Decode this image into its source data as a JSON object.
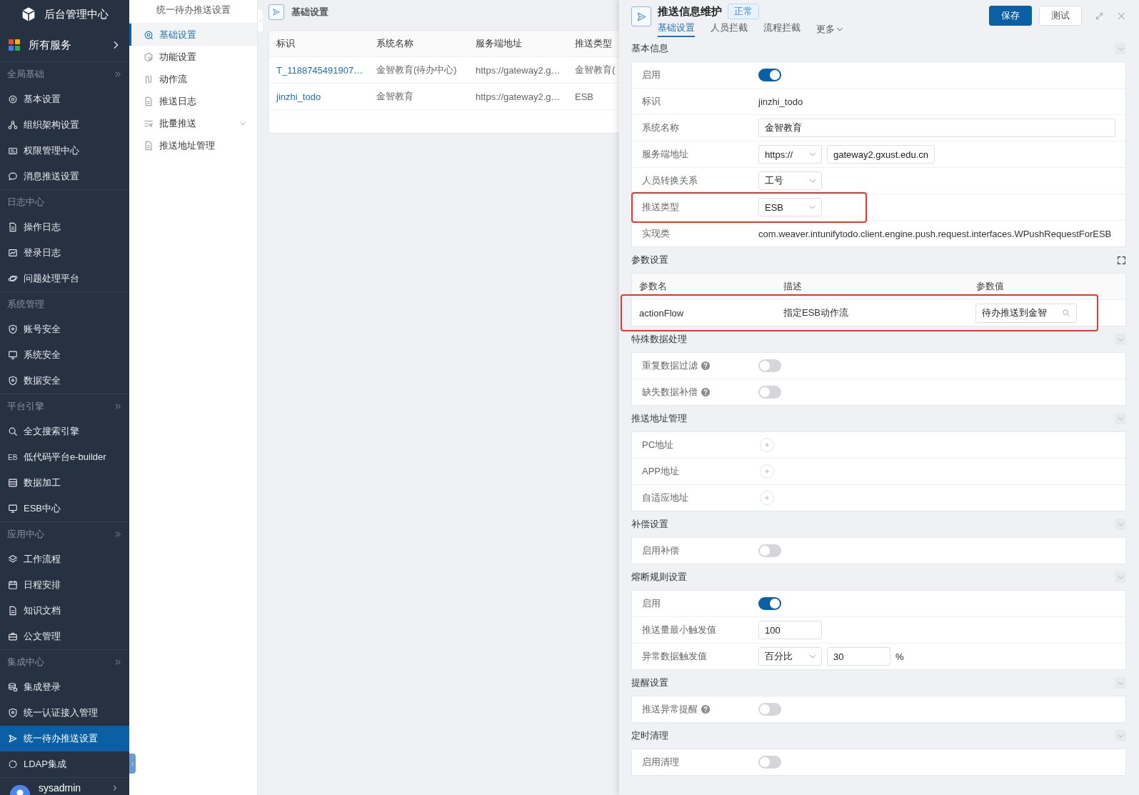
{
  "sidebar": {
    "title": "后台管理中心",
    "all_services": "所有服务",
    "groups": [
      {
        "title": "全局基础",
        "collapsible": true,
        "items": [
          {
            "label": "基本设置",
            "selected": false
          },
          {
            "label": "组织架构设置",
            "selected": false
          },
          {
            "label": "权限管理中心",
            "selected": false
          },
          {
            "label": "消息推送设置",
            "selected": false
          }
        ]
      },
      {
        "title": "日志中心",
        "collapsible": false,
        "items": [
          {
            "label": "操作日志",
            "selected": false
          },
          {
            "label": "登录日志",
            "selected": false
          },
          {
            "label": "问题处理平台",
            "selected": false
          }
        ]
      },
      {
        "title": "系统管理",
        "collapsible": false,
        "items": [
          {
            "label": "账号安全",
            "selected": false
          },
          {
            "label": "系统安全",
            "selected": false
          },
          {
            "label": "数据安全",
            "selected": false
          }
        ]
      },
      {
        "title": "平台引擎",
        "collapsible": true,
        "items": [
          {
            "label": "全文搜索引擎",
            "selected": false
          },
          {
            "label": "低代码平台e-builder",
            "selected": false,
            "icon_text": "EB"
          },
          {
            "label": "数据加工",
            "selected": false
          },
          {
            "label": "ESB中心",
            "selected": false
          }
        ]
      },
      {
        "title": "应用中心",
        "collapsible": true,
        "items": [
          {
            "label": "工作流程",
            "selected": false
          },
          {
            "label": "日程安排",
            "selected": false
          },
          {
            "label": "知识文档",
            "selected": false
          },
          {
            "label": "公文管理",
            "selected": false
          }
        ]
      },
      {
        "title": "集成中心",
        "collapsible": true,
        "items": [
          {
            "label": "集成登录",
            "selected": false
          },
          {
            "label": "统一认证接入管理",
            "selected": false
          },
          {
            "label": "统一待办推送设置",
            "selected": true
          },
          {
            "label": "LDAP集成",
            "selected": false
          }
        ]
      }
    ],
    "user": {
      "name": "sysadmin"
    }
  },
  "subnav": {
    "title": "统一待办推送设置",
    "items": [
      {
        "label": "基础设置",
        "selected": true,
        "expandable": false
      },
      {
        "label": "功能设置",
        "selected": false,
        "expandable": false
      },
      {
        "label": "动作流",
        "selected": false,
        "expandable": false
      },
      {
        "label": "推送日志",
        "selected": false,
        "expandable": false
      },
      {
        "label": "批量推送",
        "selected": false,
        "expandable": true
      },
      {
        "label": "推送地址管理",
        "selected": false,
        "expandable": false
      }
    ]
  },
  "list": {
    "title": "基础设置",
    "columns": [
      "标识",
      "系统名称",
      "服务端地址",
      "推送类型"
    ],
    "rows": [
      {
        "cells": [
          "T_1188745491907…",
          "金智教育(待办中心)",
          "https://gateway2.g…",
          "金智教育("
        ]
      },
      {
        "cells": [
          "jinzhi_todo",
          "金智教育",
          "https://gateway2.g…",
          "ESB"
        ]
      }
    ]
  },
  "drawer": {
    "title": "推送信息维护",
    "status": "正常",
    "tabs": [
      {
        "label": "基础设置",
        "selected": true
      },
      {
        "label": "人员拦截",
        "selected": false
      },
      {
        "label": "流程拦截",
        "selected": false
      }
    ],
    "more": "更多",
    "buttons": [
      {
        "label": "保存",
        "primary": true
      },
      {
        "label": "测试",
        "primary": false
      }
    ],
    "sections": [
      {
        "title": "基本信息",
        "kind": "form",
        "rows": [
          {
            "label": "启用",
            "kind": "toggle",
            "on": true,
            "help": false,
            "highlighted": false
          },
          {
            "label": "标识",
            "kind": "text",
            "value": "jinzhi_todo",
            "help": false,
            "highlighted": false
          },
          {
            "label": "系统名称",
            "kind": "input",
            "value": "金智教育",
            "help": false,
            "highlighted": false
          },
          {
            "label": "服务端地址",
            "kind": "select_input",
            "select": "https://",
            "value": "gateway2.gxust.edu.cn",
            "help": false,
            "highlighted": false
          },
          {
            "label": "人员转换关系",
            "kind": "select",
            "value": "工号",
            "help": false,
            "highlighted": false
          },
          {
            "label": "推送类型",
            "kind": "select",
            "value": "ESB",
            "help": false,
            "highlighted": true
          },
          {
            "label": "实现类",
            "kind": "text",
            "value": "com.weaver.intunifytodo.client.engine.push.request.interfaces.WPushRequestForESB",
            "help": false,
            "highlighted": false
          }
        ]
      },
      {
        "title": "参数设置",
        "kind": "table",
        "columns": [
          "参数名",
          "描述",
          "参数值"
        ],
        "rows": [
          {
            "name": "actionFlow",
            "description": "指定ESB动作流",
            "value": "待办推送到金智",
            "highlighted": true
          }
        ]
      },
      {
        "title": "特殊数据处理",
        "kind": "form",
        "rows": [
          {
            "label": "重复数据过滤",
            "kind": "toggle",
            "on": false,
            "help": true,
            "highlighted": false
          },
          {
            "label": "缺失数据补偿",
            "kind": "toggle",
            "on": false,
            "help": true,
            "highlighted": false
          }
        ]
      },
      {
        "title": "推送地址管理",
        "kind": "form",
        "rows": [
          {
            "label": "PC地址",
            "kind": "add",
            "help": false,
            "highlighted": false
          },
          {
            "label": "APP地址",
            "kind": "add",
            "help": false,
            "highlighted": false
          },
          {
            "label": "自适应地址",
            "kind": "add",
            "help": false,
            "highlighted": false
          }
        ]
      },
      {
        "title": "补偿设置",
        "kind": "form",
        "rows": [
          {
            "label": "启用补偿",
            "kind": "toggle",
            "on": false,
            "help": false,
            "highlighted": false
          }
        ]
      },
      {
        "title": "熔断规则设置",
        "kind": "form",
        "rows": [
          {
            "label": "启用",
            "kind": "toggle",
            "on": true,
            "help": false,
            "highlighted": false
          },
          {
            "label": "推送量最小触发值",
            "kind": "input_short",
            "value": "100",
            "help": false,
            "highlighted": false
          },
          {
            "label": "异常数据触发值",
            "kind": "select_input",
            "select": "百分比",
            "value": "30",
            "suffix": "%",
            "help": false,
            "highlighted": false
          }
        ]
      },
      {
        "title": "提醒设置",
        "kind": "form",
        "rows": [
          {
            "label": "推送异常提醒",
            "kind": "toggle",
            "on": false,
            "help": true,
            "highlighted": false
          }
        ]
      },
      {
        "title": "定时清理",
        "kind": "form",
        "rows": [
          {
            "label": "启用清理",
            "kind": "toggle",
            "on": false,
            "help": false,
            "highlighted": false
          }
        ]
      }
    ]
  }
}
